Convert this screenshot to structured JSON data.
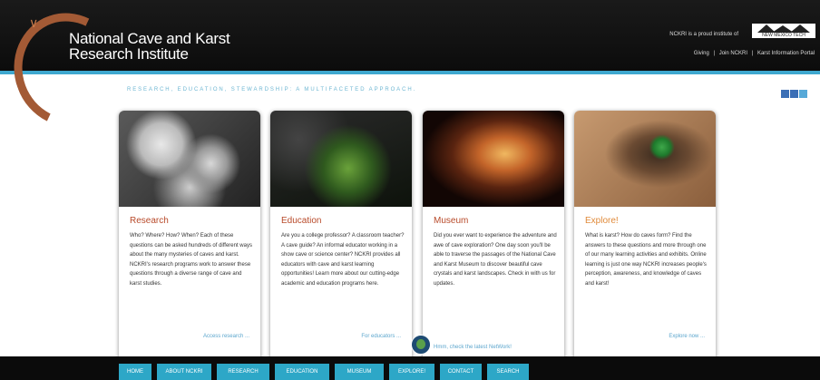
{
  "header": {
    "title_line1": "National Cave and Karst",
    "title_line2": "Research Institute",
    "partner_text": "NCKRI is a proud institute of",
    "partner_logo_text": "NEW MEXICO TECH",
    "top_links": [
      "Giving",
      "|",
      "Join NCKRI",
      "|",
      "Karst Information Portal"
    ]
  },
  "tagline": "RESEARCH, EDUCATION, STEWARDSHIP: A MULTIFACETED APPROACH.",
  "social": {
    "icons": [
      "facebook-icon",
      "linkedin-icon",
      "twitter-icon"
    ]
  },
  "cards": [
    {
      "title": "Research",
      "body": "Who? Where? How? When? Each of these questions can be asked hundreds of different ways about the many mysteries of caves and karst. NCKRI's research programs work to answer these questions through a diverse range of cave and karst studies.",
      "more": "Access research ..."
    },
    {
      "title": "Education",
      "body": "Are you a college professor? A classroom teacher? A cave guide? An informal educator working in a show cave or science center? NCKRI provides all educators with cave and karst learning opportunities! Learn more about our cutting-edge academic and education programs here.",
      "more": "For educators ..."
    },
    {
      "title": "Museum",
      "body": "Did you ever want to experience the adventure and awe of cave exploration? One day soon you'll be able to traverse the passages of the National Cave and Karst Museum to discover beautiful cave crystals and karst landscapes. Check in with us for updates.",
      "more": "Hmm, check the latest NetWork!"
    },
    {
      "title": "Explore!",
      "body": "What is karst? How do caves form? Find the answers to these questions and more through one of our many learning activities and exhibits. Online learning is just one way NCKRI increases people's perception, awareness, and knowledge of caves and karst!",
      "more": "Explore now ..."
    }
  ],
  "nav": [
    "HOME",
    "ABOUT NCKRI",
    "RESEARCH",
    "EDUCATION",
    "MUSEUM",
    "EXPLORE!",
    "CONTACT",
    "SEARCH"
  ]
}
